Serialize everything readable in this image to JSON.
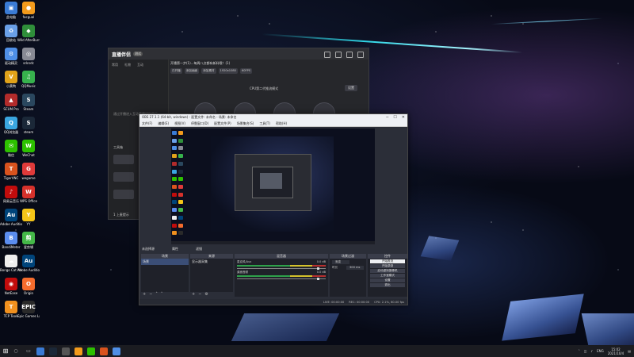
{
  "desktop": {
    "icons": [
      {
        "label": "此电脑",
        "color": "#3a7bd5",
        "glyph": "▣"
      },
      {
        "label": "facgual",
        "color": "#f39b1c",
        "glyph": "●"
      },
      {
        "label": "回收站",
        "color": "#6aa0e8",
        "glyph": "♻"
      },
      {
        "label": "Wild AfterBurner",
        "color": "#2f8f3a",
        "glyph": "◆"
      },
      {
        "label": "驱动精灵",
        "color": "#4f8fe6",
        "glyph": "⚙"
      },
      {
        "label": "sdcsdc",
        "color": "#888a94",
        "glyph": "◎"
      },
      {
        "label": "小黄鸭",
        "color": "#e0a21a",
        "glyph": "V"
      },
      {
        "label": "QQMusic",
        "color": "#37b24d",
        "glyph": "♫"
      },
      {
        "label": "SCUM Pro",
        "color": "#b22b2b",
        "glyph": "▲"
      },
      {
        "label": "Steam",
        "color": "#2a475e",
        "glyph": "S"
      },
      {
        "label": "QQ浏览器",
        "color": "#3aa6e0",
        "glyph": "Q"
      },
      {
        "label": "steam",
        "color": "#1b2838",
        "glyph": "S"
      },
      {
        "label": "微信",
        "color": "#2dc100",
        "glyph": "✉"
      },
      {
        "label": "WeChat",
        "color": "#2dc100",
        "glyph": "W"
      },
      {
        "label": "TigerVNC",
        "color": "#d9531e",
        "glyph": "T"
      },
      {
        "label": "wegame",
        "color": "#e03a3a",
        "glyph": "G"
      },
      {
        "label": "网易云音乐",
        "color": "#c20c0c",
        "glyph": "♪"
      },
      {
        "label": "WPS Office",
        "color": "#d6312b",
        "glyph": "W"
      },
      {
        "label": "Adobe Audition",
        "color": "#00447a",
        "glyph": "Au"
      },
      {
        "label": "YY",
        "color": "#f5c518",
        "glyph": "Y"
      },
      {
        "label": "BandiMeter",
        "color": "#5b8def",
        "glyph": "B"
      },
      {
        "label": "爱剪辑",
        "color": "#44b848",
        "glyph": "剪"
      },
      {
        "label": "Bongo Cat Mver",
        "color": "#eeeeee",
        "glyph": "☁"
      },
      {
        "label": "Adobe Audition",
        "color": "#00447a",
        "glyph": "Au"
      },
      {
        "label": "NetEase",
        "color": "#c20c0c",
        "glyph": "◉"
      },
      {
        "label": "Origin",
        "color": "#f56c2d",
        "glyph": "O"
      },
      {
        "label": "TCP Tools",
        "color": "#f0901e",
        "glyph": "T"
      },
      {
        "label": "Epic Games Launcher",
        "color": "#2a2a2a",
        "glyph": "EPIC"
      }
    ]
  },
  "back_window": {
    "app_name": "直播伴侣",
    "version": "测试",
    "tabs": [
      "常用",
      "礼物",
      "互动"
    ],
    "hint": "通过开播进入互动直播间后显示",
    "section": "工具箱",
    "bottom": "1 上麦提示",
    "announcement": "开播第一步(1)...每周八点都有新料哦！(1)",
    "badges": [
      "已开播",
      "添加画面",
      "添加素材",
      "1920x1080",
      "60FPS"
    ],
    "mode_label": "CPU第二代推流模式",
    "settings": "设置"
  },
  "obs": {
    "title": "OBS 27.1.1 (64-bit, windows) - 配置文件: 未命名 - 场景: 未命名",
    "menu": [
      "文件(F)",
      "编辑(E)",
      "视图(V)",
      "停靠窗口(D)",
      "配置文件(P)",
      "场景集合(S)",
      "工具(T)",
      "帮助(H)"
    ],
    "selection": "未选择源",
    "props_btn": "属性",
    "filter_btn": "滤镜",
    "docks": {
      "scenes": {
        "title": "场景",
        "items": [
          "场景"
        ]
      },
      "sources": {
        "title": "来源",
        "items": [
          "显示器采集"
        ]
      },
      "mixer": {
        "title": "混音器",
        "rows": [
          {
            "name": "麦克风/Aux",
            "db": "0.0 dB"
          },
          {
            "name": "桌面音频",
            "db": "0.0 dB"
          }
        ]
      },
      "transitions": {
        "title": "场景过渡",
        "type_label": "渐变",
        "duration_label": "时长",
        "duration": "300 ms"
      },
      "controls": {
        "title": "控件",
        "buttons": [
          "开始推流",
          "开始录制",
          "启动虚拟摄像机",
          "工作室模式",
          "设置",
          "退出"
        ]
      }
    },
    "status": [
      "LIVE: 00:00:00",
      "REC: 00:00:00",
      "CPU: 2.1%, 60.00 fps"
    ]
  },
  "taskbar": {
    "time": "15:02",
    "date": "2021/10/4",
    "lang": "ENG"
  }
}
